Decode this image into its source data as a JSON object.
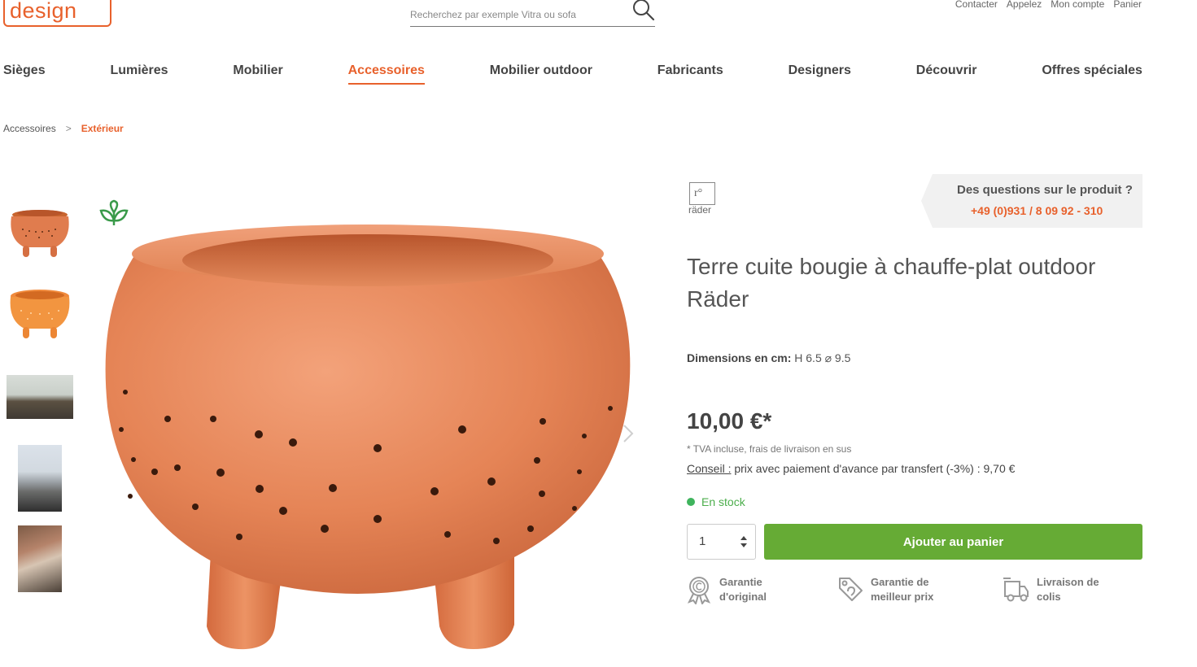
{
  "header": {
    "logo_text": "design",
    "search_placeholder": "Recherchez par exemple Vitra ou sofa",
    "top_links": [
      "Contacter",
      "Appelez",
      "Mon compte",
      "Panier"
    ]
  },
  "nav": {
    "items": [
      "Sièges",
      "Lumières",
      "Mobilier",
      "Accessoires",
      "Mobilier outdoor",
      "Fabricants",
      "Designers",
      "Découvrir",
      "Offres spéciales"
    ],
    "active": "Accessoires"
  },
  "breadcrumb": {
    "items": [
      "Accessoires",
      "Extérieur"
    ],
    "separator": ">"
  },
  "gallery": {
    "thumbnails": 5,
    "badge_icon": "eco-leaf-icon",
    "next_icon": "chevron-right-icon"
  },
  "product": {
    "brand": "räder",
    "brand_mark": "r°",
    "title": "Terre cuite bougie à chauffe-plat outdoor Räder",
    "dimensions_label": "Dimensions en cm:",
    "dimensions_value": "H 6.5 ⌀ 9.5",
    "price": "10,00 €*",
    "tax_note": "* TVA incluse, frais de livraison en sus",
    "tip_label": "Conseil :",
    "tip_text": " prix avec paiement d'avance par transfert (-3%) : 9,70 €",
    "stock": "En stock",
    "quantity": "1",
    "cart_button": "Ajouter au panier"
  },
  "help": {
    "question": "Des questions sur le produit ?",
    "phone": "+49 (0)931 / 8 09 92 - 310"
  },
  "features": [
    {
      "line1": "Garantie",
      "line2": "d'original",
      "icon": "certificate-icon"
    },
    {
      "line1": "Garantie de",
      "line2": "meilleur prix",
      "icon": "price-tag-icon"
    },
    {
      "line1": "Livraison de",
      "line2": "colis",
      "icon": "delivery-truck-icon"
    }
  ],
  "colors": {
    "accent": "#e8612c",
    "cart_green": "#66ab35",
    "stock_green": "#3fb45d",
    "terracotta": "#e07c4e"
  }
}
